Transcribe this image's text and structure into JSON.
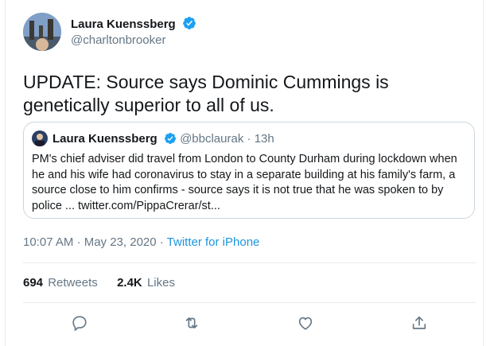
{
  "tweet": {
    "author_name": "Laura Kuenssberg",
    "author_handle": "@charltonbrooker",
    "text": "UPDATE: Source says Dominic Cummings is genetically superior to all of us.",
    "timestamp": "10:07 AM · May 23, 2020",
    "separator": " · ",
    "source": "Twitter for iPhone"
  },
  "quoted": {
    "author_name": "Laura Kuenssberg",
    "author_handle": "@bbclaurak",
    "age": "13h",
    "text": "PM's chief adviser did travel from London to County Durham during lockdown when he and his wife had coronavirus to stay in a separate building at his family's farm, a source close to him confirms - source says it is not true that he was spoken to by police ... twitter.com/PippaCrerar/st..."
  },
  "stats": {
    "retweets_count": "694",
    "retweets_label": "Retweets",
    "likes_count": "2.4K",
    "likes_label": "Likes"
  },
  "actions": {
    "icons": [
      "reply-icon",
      "retweet-icon",
      "like-icon",
      "share-icon"
    ]
  },
  "colors": {
    "verified": "#1da1f2",
    "link": "#1b95e0",
    "muted": "#657786",
    "border": "#e6ecf0"
  }
}
